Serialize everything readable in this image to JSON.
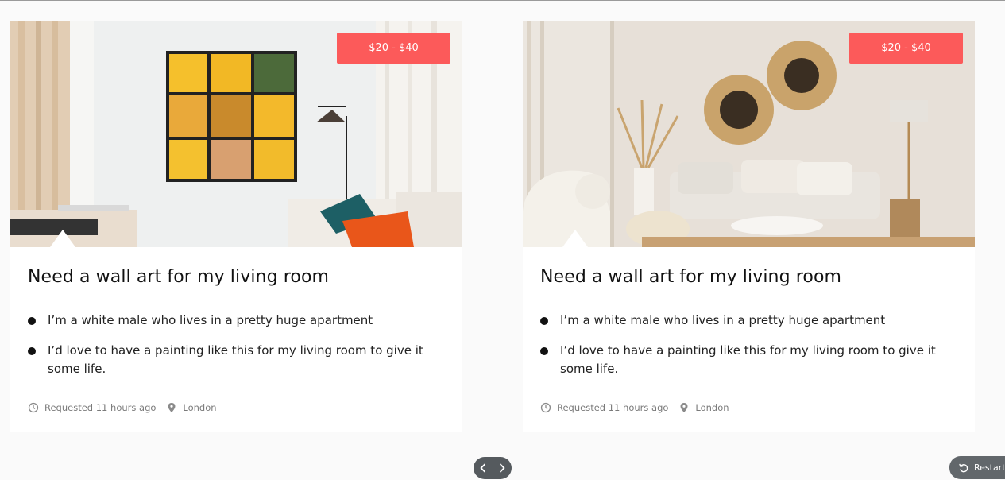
{
  "cards": [
    {
      "price": "$20 - $40",
      "title": "Need a wall art for my living room",
      "bullets": [
        "I’m a white male who lives in a pretty huge apartment",
        "I’d love to have a painting like this for my living room to give it some life."
      ],
      "requested": "Requested 11 hours ago",
      "location": "London"
    },
    {
      "price": "$20 - $40",
      "title": "Need a wall art for my living room",
      "bullets": [
        "I’m a white male who lives in a pretty huge apartment",
        "I’d love to have a painting like this for my living room to give it some life."
      ],
      "requested": "Requested 11 hours ago",
      "location": "London"
    }
  ],
  "pager": {
    "prev_icon": "chevron-left-icon",
    "next_icon": "chevron-right-icon"
  },
  "restart": {
    "label": "Restart",
    "icon": "restart-icon"
  },
  "colors": {
    "price_badge": "#fc5a5a",
    "pager_bg": "#555a5e",
    "meta_text": "#7a7a7a"
  }
}
